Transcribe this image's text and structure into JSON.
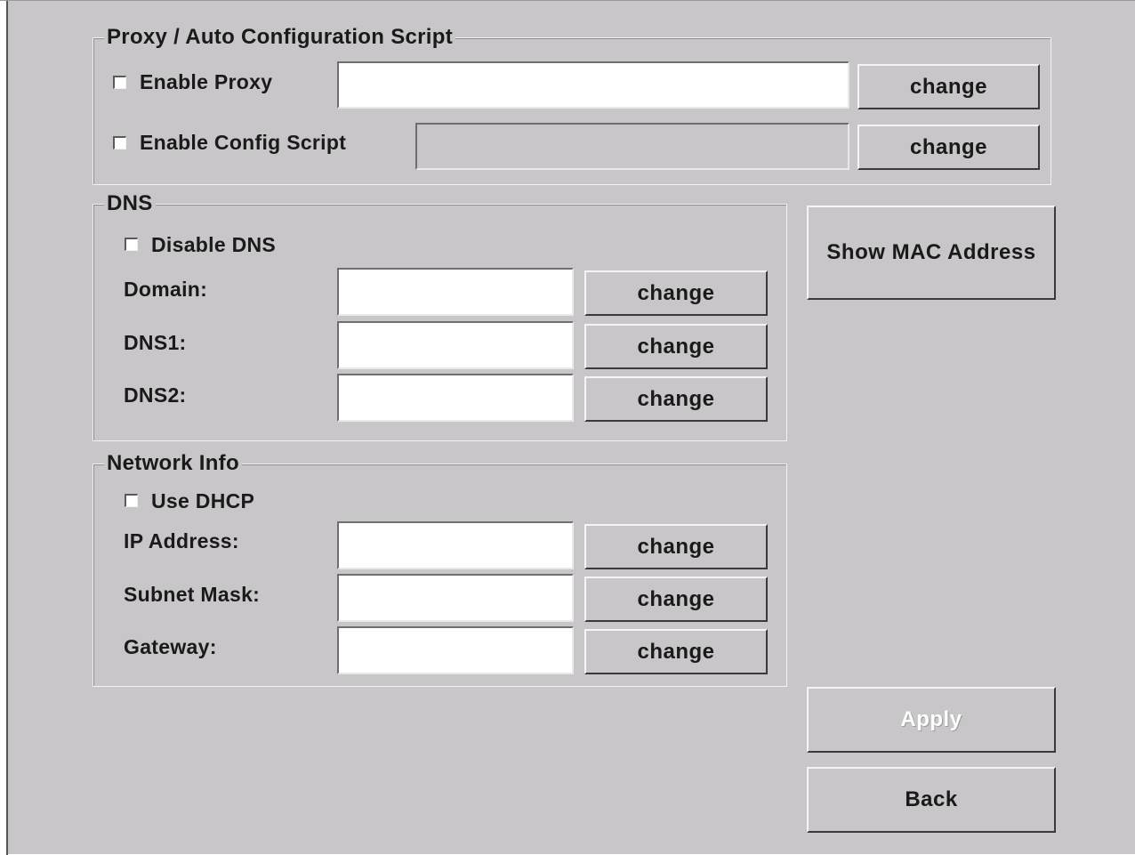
{
  "proxy": {
    "legend": "Proxy / Auto Configuration Script",
    "enable_proxy_label": "Enable Proxy",
    "enable_proxy_checked": false,
    "proxy_value": "",
    "enable_script_label": "Enable Config Script",
    "enable_script_checked": false,
    "script_value": "",
    "change_label": "change"
  },
  "dns": {
    "legend": "DNS",
    "disable_label": "Disable DNS",
    "disable_checked": false,
    "domain_label": "Domain:",
    "domain_value": "",
    "dns1_label": "DNS1:",
    "dns1_value": "",
    "dns2_label": "DNS2:",
    "dns2_value": "",
    "change_label": "change"
  },
  "network": {
    "legend": "Network Info",
    "dhcp_label": "Use DHCP",
    "dhcp_checked": false,
    "ip_label": "IP Address:",
    "ip_value": "",
    "subnet_label": "Subnet Mask:",
    "subnet_value": "",
    "gateway_label": "Gateway:",
    "gateway_value": "",
    "change_label": "change"
  },
  "actions": {
    "show_mac_label": "Show MAC Address",
    "apply_label": "Apply",
    "apply_enabled": false,
    "back_label": "Back"
  }
}
